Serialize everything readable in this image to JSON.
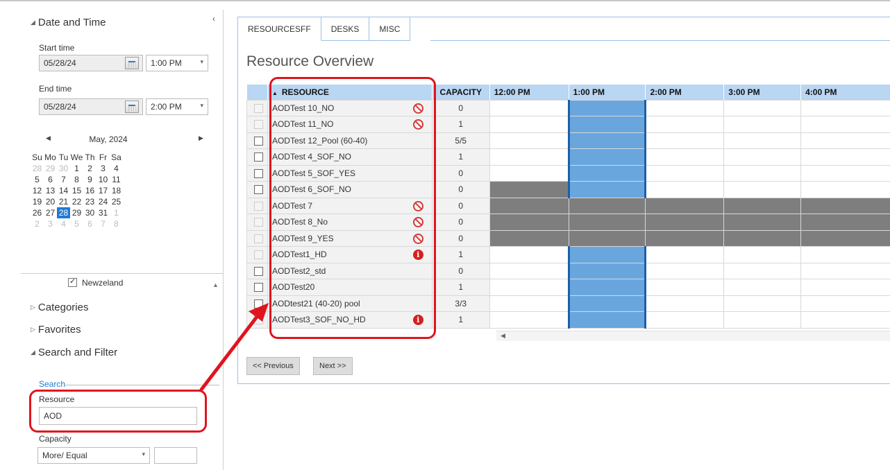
{
  "left": {
    "date_time_title": "Date and Time",
    "start_time_label": "Start time",
    "start_date": "05/28/24",
    "start_time": "1:00 PM",
    "end_time_label": "End time",
    "end_date": "05/28/24",
    "end_time": "2:00 PM",
    "calendar": {
      "month": "May, 2024",
      "weekdays": [
        "Su",
        "Mo",
        "Tu",
        "We",
        "Th",
        "Fr",
        "Sa"
      ],
      "weeks": [
        [
          "28",
          "29",
          "30",
          "1",
          "2",
          "3",
          "4"
        ],
        [
          "5",
          "6",
          "7",
          "8",
          "9",
          "10",
          "11"
        ],
        [
          "12",
          "13",
          "14",
          "15",
          "16",
          "17",
          "18"
        ],
        [
          "19",
          "20",
          "21",
          "22",
          "23",
          "24",
          "25"
        ],
        [
          "26",
          "27",
          "28",
          "29",
          "30",
          "31",
          "1"
        ],
        [
          "2",
          "3",
          "4",
          "5",
          "6",
          "7",
          "8"
        ]
      ],
      "selected": "28"
    },
    "location_option": "Newzeland",
    "categories_title": "Categories",
    "favorites_title": "Favorites",
    "search_filter_title": "Search and Filter",
    "search_label": "Search",
    "resource_label": "Resource",
    "resource_value": "AOD",
    "capacity_label": "Capacity",
    "capacity_operator": "More/ Equal",
    "capacity_value": ""
  },
  "tabs": [
    "RESOURCESFF",
    "DESKS",
    "MISC"
  ],
  "page_title": "Resource Overview",
  "grid": {
    "headers": {
      "resource": "RESOURCE",
      "capacity": "CAPACITY",
      "times": [
        "12:00 PM",
        "1:00 PM",
        "2:00 PM",
        "3:00 PM",
        "4:00 PM"
      ]
    },
    "rows": [
      {
        "name": "AODTest 10_NO",
        "capacity": "0",
        "status": "forbidden",
        "enabled": false,
        "busy": []
      },
      {
        "name": "AODTest 11_NO",
        "capacity": "1",
        "status": "forbidden",
        "enabled": false,
        "busy": []
      },
      {
        "name": "AODTest 12_Pool (60-40)",
        "capacity": "5/5",
        "status": "",
        "enabled": true,
        "busy": []
      },
      {
        "name": "AODTest 4_SOF_NO",
        "capacity": "1",
        "status": "",
        "enabled": true,
        "busy": []
      },
      {
        "name": "AODTest 5_SOF_YES",
        "capacity": "0",
        "status": "",
        "enabled": true,
        "busy": []
      },
      {
        "name": "AODTest 6_SOF_NO",
        "capacity": "0",
        "status": "",
        "enabled": true,
        "busy": [
          0
        ]
      },
      {
        "name": "AODTest 7",
        "capacity": "0",
        "status": "forbidden",
        "enabled": false,
        "busy": [
          0,
          1,
          2,
          3,
          4
        ]
      },
      {
        "name": "AODTest 8_No",
        "capacity": "0",
        "status": "forbidden",
        "enabled": false,
        "busy": [
          0,
          1,
          2,
          3,
          4
        ]
      },
      {
        "name": "AODTest 9_YES",
        "capacity": "0",
        "status": "forbidden",
        "enabled": false,
        "busy": [
          0,
          1,
          2,
          3,
          4
        ]
      },
      {
        "name": "AODTest1_HD",
        "capacity": "1",
        "status": "info",
        "enabled": false,
        "busy": []
      },
      {
        "name": "AODTest2_std",
        "capacity": "0",
        "status": "",
        "enabled": true,
        "busy": []
      },
      {
        "name": "AODTest20",
        "capacity": "1",
        "status": "",
        "enabled": true,
        "busy": []
      },
      {
        "name": "AODtest21 (40-20) pool",
        "capacity": "3/3",
        "status": "",
        "enabled": true,
        "busy": []
      },
      {
        "name": "AODTest3_SOF_NO_HD",
        "capacity": "1",
        "status": "info",
        "enabled": false,
        "busy": []
      }
    ],
    "selected_slot": 1
  },
  "buttons": {
    "previous": "<< Previous",
    "next": "Next >>"
  },
  "colors": {
    "annotation": "#e0141e",
    "header_bg": "#b9d6f2",
    "selected_slot": "#6aa6de",
    "busy": "#7e7e7e",
    "accent": "#1e7ad6"
  },
  "icons": {
    "forbidden": "forbidden-icon",
    "info": "info-icon"
  }
}
